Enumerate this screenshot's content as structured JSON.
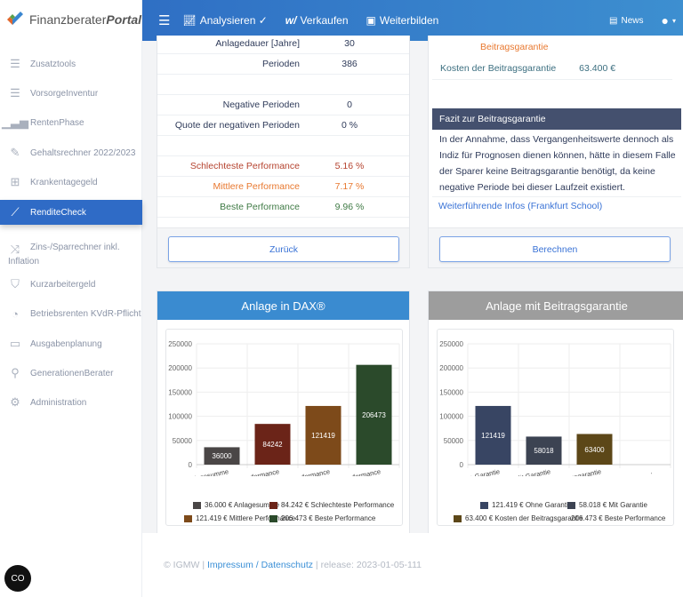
{
  "logo": {
    "text1": "Finanzberater",
    "text2": "Portal"
  },
  "header": {
    "nav": [
      {
        "label": "Analysieren ✓",
        "icon": "chart-line-icon"
      },
      {
        "label": "Verkaufen",
        "icon": "signature-icon"
      },
      {
        "label": "Weiterbilden",
        "icon": "presentation-icon"
      }
    ],
    "news": "News"
  },
  "sidebar": {
    "items": [
      {
        "label": "Zusatztools",
        "icon": "list-icon"
      },
      {
        "label": "VorsorgeInventur",
        "icon": "list-icon"
      },
      {
        "label": "RentenPhase",
        "icon": "bar-chart-icon"
      },
      {
        "label": "Gehaltsrechner 2022/2023",
        "icon": "edit-icon"
      },
      {
        "label": "Krankentagegeld",
        "icon": "medical-case-icon"
      },
      {
        "label": "RenditeCheck",
        "icon": "trend-icon",
        "active": true
      },
      {
        "label": "Zins-/Sparrechner inkl.",
        "label2": "Inflation",
        "icon": "shuffle-icon"
      },
      {
        "label": "Kurzarbeitergeld",
        "icon": "shield-icon"
      },
      {
        "label": "Betriebsrenten KVdR-Pflicht",
        "icon": "pie-icon"
      },
      {
        "label": "Ausgabenplanung",
        "icon": "wallet-icon"
      },
      {
        "label": "GenerationenBerater",
        "icon": "pin-icon"
      },
      {
        "label": "Administration",
        "icon": "gear-icon"
      }
    ]
  },
  "left_table": {
    "rows": [
      {
        "label": "Anlagedauer [Jahre]",
        "value": "30"
      },
      {
        "label": "Perioden",
        "value": "386"
      },
      {
        "label": "",
        "value": ""
      },
      {
        "label": "Negative Perioden",
        "value": "0"
      },
      {
        "label": "Quote der negativen Perioden",
        "value": "0 %"
      },
      {
        "label": "",
        "value": ""
      },
      {
        "label": "Schlechteste Performance",
        "value": "5.16 %",
        "color": "#b5432f"
      },
      {
        "label": "Mittlere Performance",
        "value": "7.17 %",
        "color": "#e8782f"
      },
      {
        "label": "Beste Performance",
        "value": "9.96 %",
        "color": "#3f7a45"
      }
    ],
    "button": "Zurück"
  },
  "right_panel": {
    "top_label": "Beitragsgarantie",
    "cost_label": "Kosten der Beitragsgarantie",
    "cost_value": "63.400 €",
    "fazit_title": "Fazit zur Beitragsgarantie",
    "fazit_text": "In der Annahme, dass Vergangenheitswerte dennoch als Indiz für Prognosen dienen können, hätte in diesem Falle der Sparer keine Beitragsgarantie benötigt, da keine negative Periode bei dieser Laufzeit existiert.",
    "link": "Weiterführende Infos (Frankfurt School)",
    "button": "Berechnen"
  },
  "chart_data": [
    {
      "type": "bar",
      "title": "Anlage in DAX®",
      "header_color": "#3a8bd0",
      "categories": [
        "Anlagesumme",
        "Schlechteste Performance",
        "Mittlere Performance",
        "Beste Performance"
      ],
      "values": [
        36000,
        84242,
        121419,
        206473
      ],
      "colors": [
        "#4a4646",
        "#6b2418",
        "#7d4a1a",
        "#2b4a2b"
      ],
      "ylim": [
        0,
        250000
      ],
      "yticks": [
        "0",
        "50000",
        "100000",
        "150000",
        "200000",
        "250000"
      ],
      "grid": true,
      "legend": [
        "36.000 €  Anlagesumme",
        "84.242 €  Schlechteste Performance",
        "121.419 €  Mittlere Performance",
        "206.473 €  Beste Performance"
      ],
      "legend_placement": "bottom"
    },
    {
      "type": "bar",
      "title": "Anlage mit Beitragsgarantie",
      "header_color": "#9d9d9d",
      "categories": [
        "Ohne Garantie",
        "Mit Garantie",
        "Kosten der Beitragsgarantie",
        "."
      ],
      "values": [
        121419,
        58018,
        63400,
        null
      ],
      "colors": [
        "#384563",
        "#3c4352",
        "#5c4718",
        "#ffffff"
      ],
      "ylim": [
        0,
        250000
      ],
      "yticks": [
        "0",
        "50000",
        "100000",
        "150000",
        "200000",
        "250000"
      ],
      "grid": true,
      "legend": [
        "121.419 €  Ohne Garantie",
        "58.018 €  Mit Garantie",
        "63.400 €  Kosten der Beitragsgarantie",
        "206.473 €  Beste Performance"
      ],
      "legend_placement": "bottom"
    }
  ],
  "footer": {
    "copy": "© IGMW | ",
    "link": "Impressum / Datenschutz",
    "release": " | release: 2023-01-05-111"
  }
}
